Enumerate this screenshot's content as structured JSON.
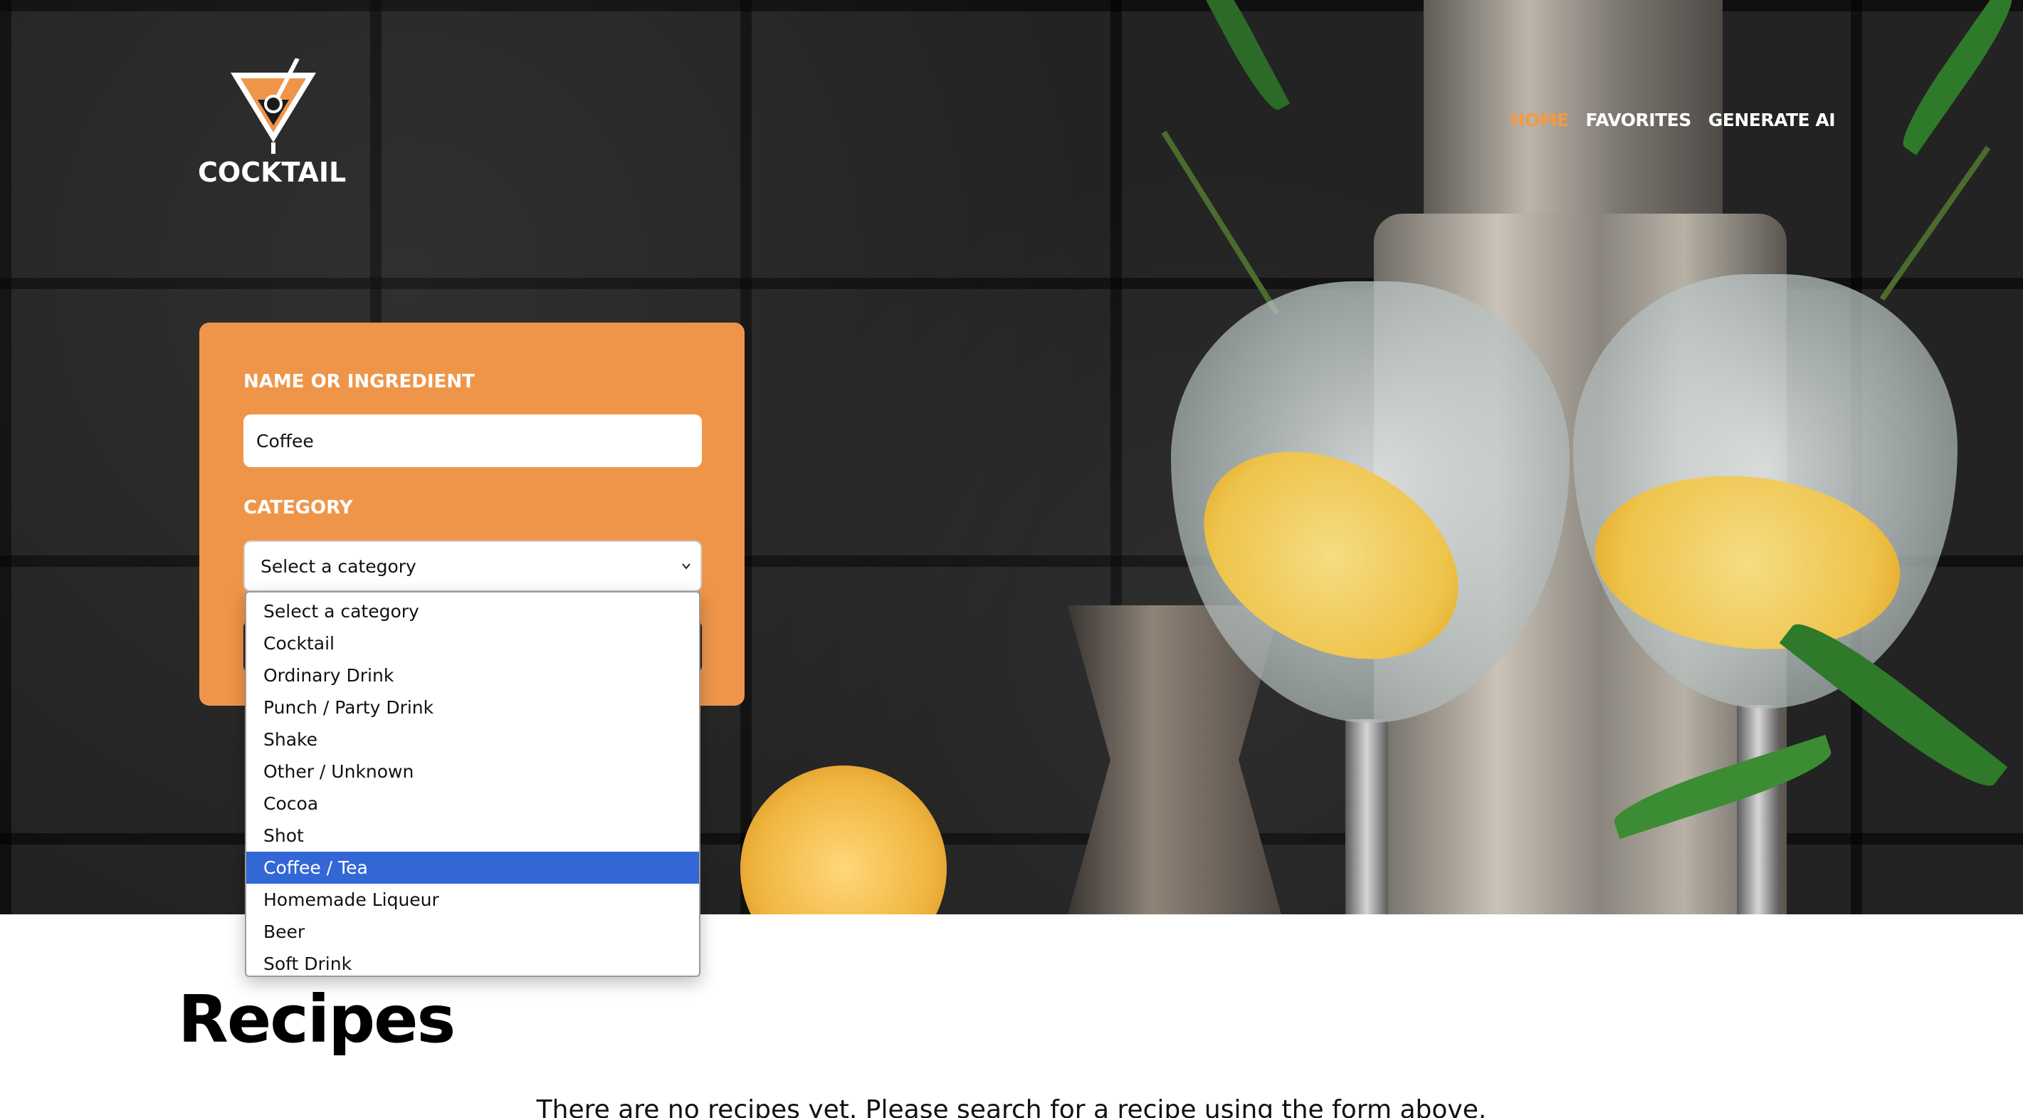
{
  "brand": {
    "name": "COCKTAIL"
  },
  "nav": {
    "items": [
      {
        "label": "HOME",
        "active": true
      },
      {
        "label": "FAVORITES",
        "active": false
      },
      {
        "label": "GENERATE AI",
        "active": false
      }
    ]
  },
  "search_form": {
    "name_label": "NAME OR INGREDIENT",
    "name_value": "Coffee",
    "category_label": "CATEGORY",
    "category_selected": "Select a category",
    "category_options": [
      "Select a category",
      "Cocktail",
      "Ordinary Drink",
      "Punch / Party Drink",
      "Shake",
      "Other / Unknown",
      "Cocoa",
      "Shot",
      "Coffee / Tea",
      "Homemade Liqueur",
      "Beer",
      "Soft Drink"
    ],
    "highlighted_option": "Coffee / Tea"
  },
  "content": {
    "title": "Recipes",
    "empty_message": "There are no recipes yet. Please search for a recipe using the form above."
  },
  "colors": {
    "accent": "#ef9549",
    "nav_active": "#f29a45",
    "highlight": "#3367d6"
  },
  "icons": {
    "logo": "martini-glass-icon",
    "select": "chevron-down-icon"
  }
}
